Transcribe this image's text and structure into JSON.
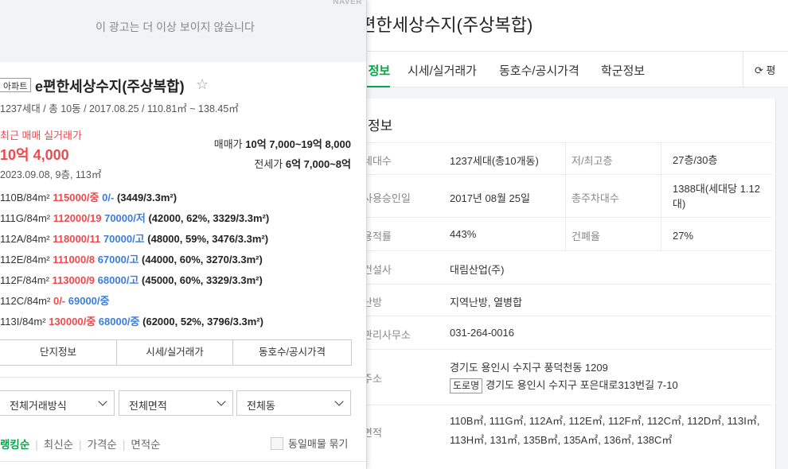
{
  "right_panel": {
    "title": "e편한세상수지(주상복합)",
    "tabs": [
      "단지정보",
      "시세/실거래가",
      "동호수/공시가격",
      "학군정보"
    ],
    "refresh_label": "평",
    "section_title": "단지 정보",
    "rows": [
      {
        "label": "세대수",
        "value": "1237세대(총10개동)",
        "label2": "저/최고층",
        "value2": "27층/30층"
      },
      {
        "label": "사용승인일",
        "value": "2017년 08월 25일",
        "label2": "총주차대수",
        "value2": "1388대(세대당 1.12대)"
      },
      {
        "label": "용적률",
        "value": "443%",
        "label2": "건폐율",
        "value2": "27%"
      },
      {
        "label": "건설사",
        "value": "대림산업(주)"
      },
      {
        "label": "난방",
        "value": "지역난방, 열병합"
      },
      {
        "label": "관리사무소",
        "value": "031-264-0016"
      },
      {
        "label": "주소",
        "value": "경기도 용인시 수지구 풍덕천동 1209",
        "road_badge": "도로명",
        "road_value": "경기도 용인시 수지구 포은대로313번길 7-10"
      },
      {
        "label": "면적",
        "value": "110B㎡, 111G㎡, 112A㎡, 112E㎡, 112F㎡, 112C㎡, 112D㎡, 113I㎡, 113H㎡, 131㎡, 135B㎡, 135A㎡, 136㎡, 138C㎡"
      }
    ]
  },
  "left_panel": {
    "ad_brand": "NAVER",
    "ad_text": "이 광고는 더 이상 보이지 않습니다",
    "badge": "아파트",
    "name": "e편한세상수지(주상복합)",
    "meta": "1237세대 / 총 10동 / 2017.08.25 / 110.81㎡ ~ 138.45㎡",
    "recent_label": "최근 매매 실거래가",
    "recent_price": "10억 4,000",
    "recent_date": "2023.09.08, 9층, 113㎡",
    "sale_label": "매매가",
    "sale_range": "10억 7,000~19억 8,000",
    "jeonse_label": "전세가",
    "jeonse_range": "6억 7,000~8억",
    "units": [
      {
        "type": "110B/84m²",
        "sale": "115000/중",
        "rent": "0/-",
        "detail": "(3449/3.3m²)"
      },
      {
        "type": "111G/84m²",
        "sale": "112000/19",
        "rent": "70000/저",
        "detail": "(42000, 62%, 3329/3.3m²)"
      },
      {
        "type": "112A/84m²",
        "sale": "118000/11",
        "rent": "70000/고",
        "detail": "(48000, 59%, 3476/3.3m²)"
      },
      {
        "type": "112E/84m²",
        "sale": "111000/8",
        "rent": "67000/고",
        "detail": "(44000, 60%, 3270/3.3m²)"
      },
      {
        "type": "112F/84m²",
        "sale": "113000/9",
        "rent": "68000/고",
        "detail": "(45000, 60%, 3329/3.3m²)"
      },
      {
        "type": "112C/84m²",
        "sale": "0/-",
        "rent": "69000/중",
        "detail": ""
      },
      {
        "type": "113I/84m²",
        "sale": "130000/중",
        "rent": "68000/중",
        "detail": "(62000, 52%, 3796/3.3m²)"
      }
    ],
    "buttons": [
      "단지정보",
      "시세/실거래가",
      "동호수/공시가격"
    ],
    "filters": [
      "전체거래방식",
      "전체면적",
      "전체동"
    ],
    "sorts": [
      "랭킹순",
      "최신순",
      "가격순",
      "면적순"
    ],
    "group_label": "동일매물 묶기"
  }
}
